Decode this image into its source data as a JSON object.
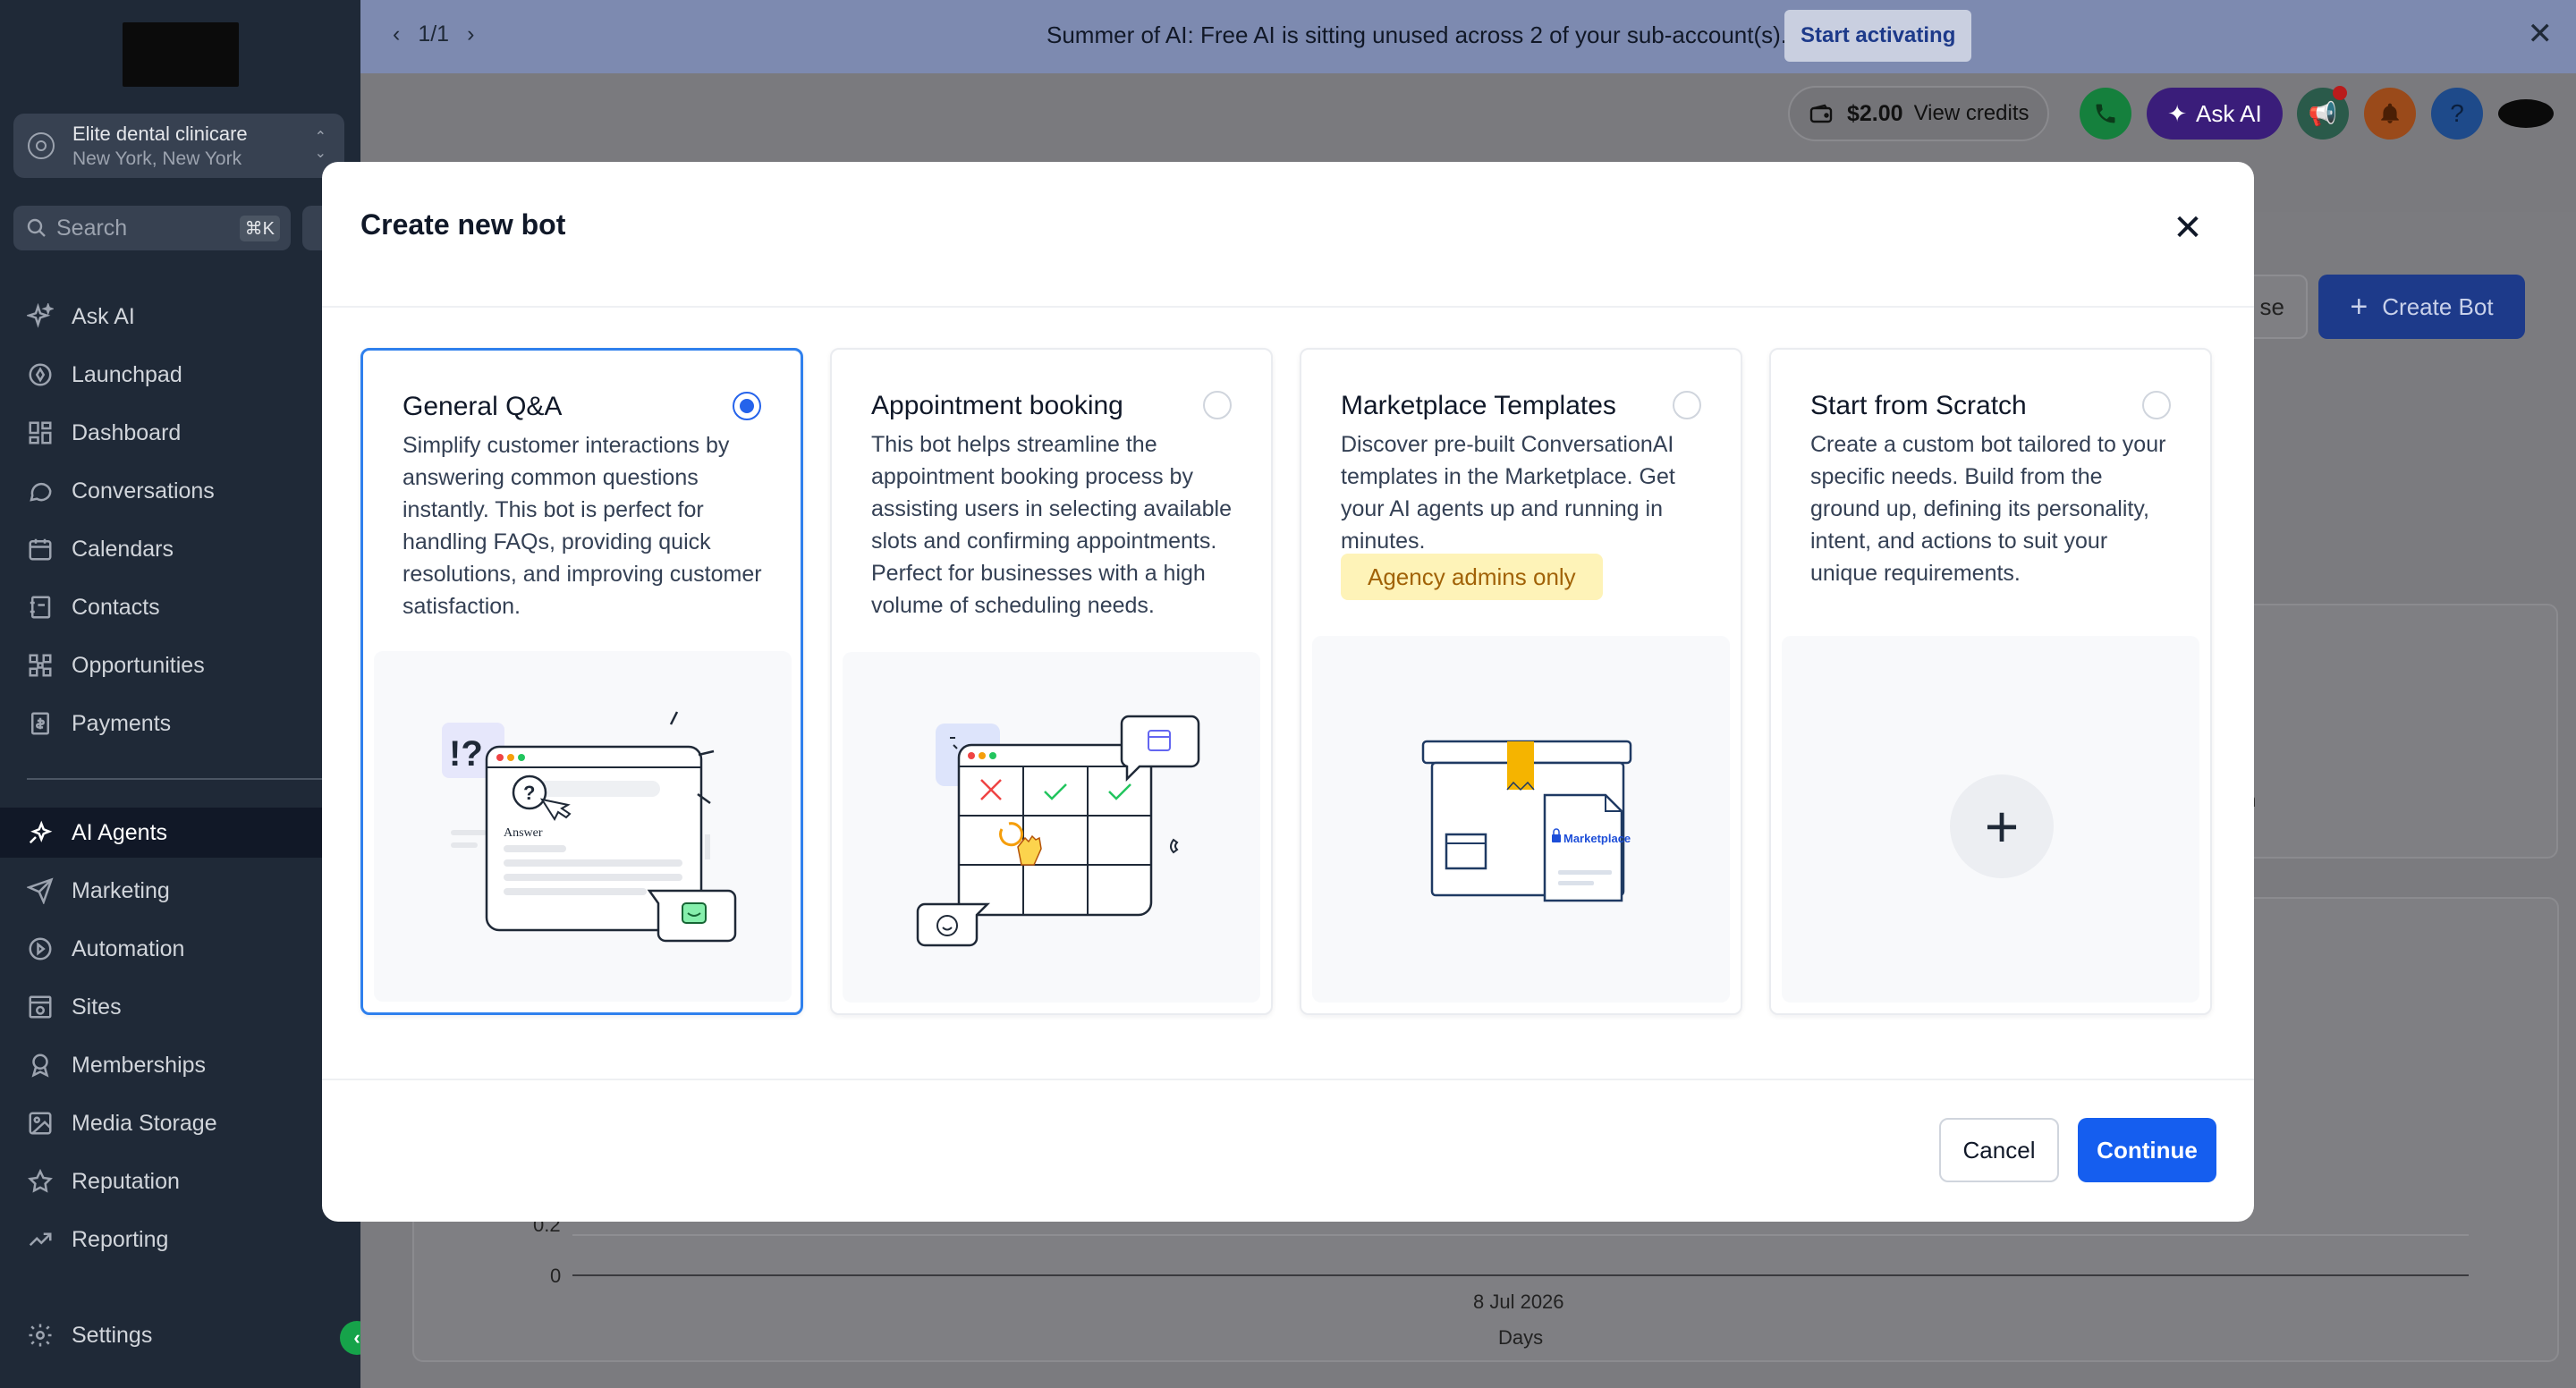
{
  "banner": {
    "pager": "1/1",
    "message": "Summer of AI: Free AI is sitting unused across 2 of your sub-account(s).",
    "cta": "Start activating"
  },
  "account": {
    "name": "Elite dental clinicare",
    "location": "New York, New York"
  },
  "search": {
    "placeholder": "Search",
    "shortcut": "⌘K"
  },
  "nav": {
    "items": [
      {
        "label": "Ask AI",
        "icon": "sparkle-icon"
      },
      {
        "label": "Launchpad",
        "icon": "rocket-icon"
      },
      {
        "label": "Dashboard",
        "icon": "grid-icon"
      },
      {
        "label": "Conversations",
        "icon": "chat-icon"
      },
      {
        "label": "Calendars",
        "icon": "calendar-icon"
      },
      {
        "label": "Contacts",
        "icon": "contacts-icon"
      },
      {
        "label": "Opportunities",
        "icon": "opportunities-icon"
      },
      {
        "label": "Payments",
        "icon": "payments-icon"
      }
    ],
    "items2": [
      {
        "label": "AI Agents",
        "icon": "ai-agents-icon"
      },
      {
        "label": "Marketing",
        "icon": "send-icon"
      },
      {
        "label": "Automation",
        "icon": "automation-icon"
      },
      {
        "label": "Sites",
        "icon": "sites-icon"
      },
      {
        "label": "Memberships",
        "icon": "memberships-icon"
      },
      {
        "label": "Media Storage",
        "icon": "image-icon"
      },
      {
        "label": "Reputation",
        "icon": "star-icon"
      },
      {
        "label": "Reporting",
        "icon": "trend-icon"
      }
    ],
    "settings": "Settings"
  },
  "header": {
    "credits_amount": "$2.00",
    "credits_label": "View credits",
    "ask_ai": "Ask AI"
  },
  "background": {
    "create_bot": "Create Bot",
    "other_btn": "se",
    "tick_02": "0.2",
    "tick_0": "0",
    "x_date": "8 Jul 2026",
    "x_title": "Days",
    "partial": "n"
  },
  "modal": {
    "title": "Create new bot",
    "options": [
      {
        "title": "General Q&A",
        "description": "Simplify customer interactions by answering common questions instantly. This bot is perfect for handling FAQs, providing quick resolutions, and improving customer satisfaction.",
        "selected": true
      },
      {
        "title": "Appointment booking",
        "description": "This bot helps streamline the appointment booking process by assisting users in selecting available slots and confirming appointments. Perfect for businesses with a high volume of scheduling needs.",
        "selected": false
      },
      {
        "title": "Marketplace Templates",
        "description": "Discover pre-built ConversationAI templates in the Marketplace. Get your AI agents up and running in minutes.",
        "badge": "Agency admins only",
        "illustration_label": "Marketplace",
        "selected": false
      },
      {
        "title": "Start from Scratch",
        "description": "Create a custom bot tailored to your specific needs. Build from the ground up, defining its personality, intent, and actions to suit your unique requirements.",
        "selected": false
      }
    ],
    "illus_qa": {
      "mark": "!?",
      "answer": "Answer",
      "question": "?"
    },
    "cancel": "Cancel",
    "continue": "Continue"
  },
  "colors": {
    "primary": "#155eef",
    "sidebar": "#1f2937",
    "badge_bg": "#fef3b8",
    "badge_text": "#a16207"
  }
}
